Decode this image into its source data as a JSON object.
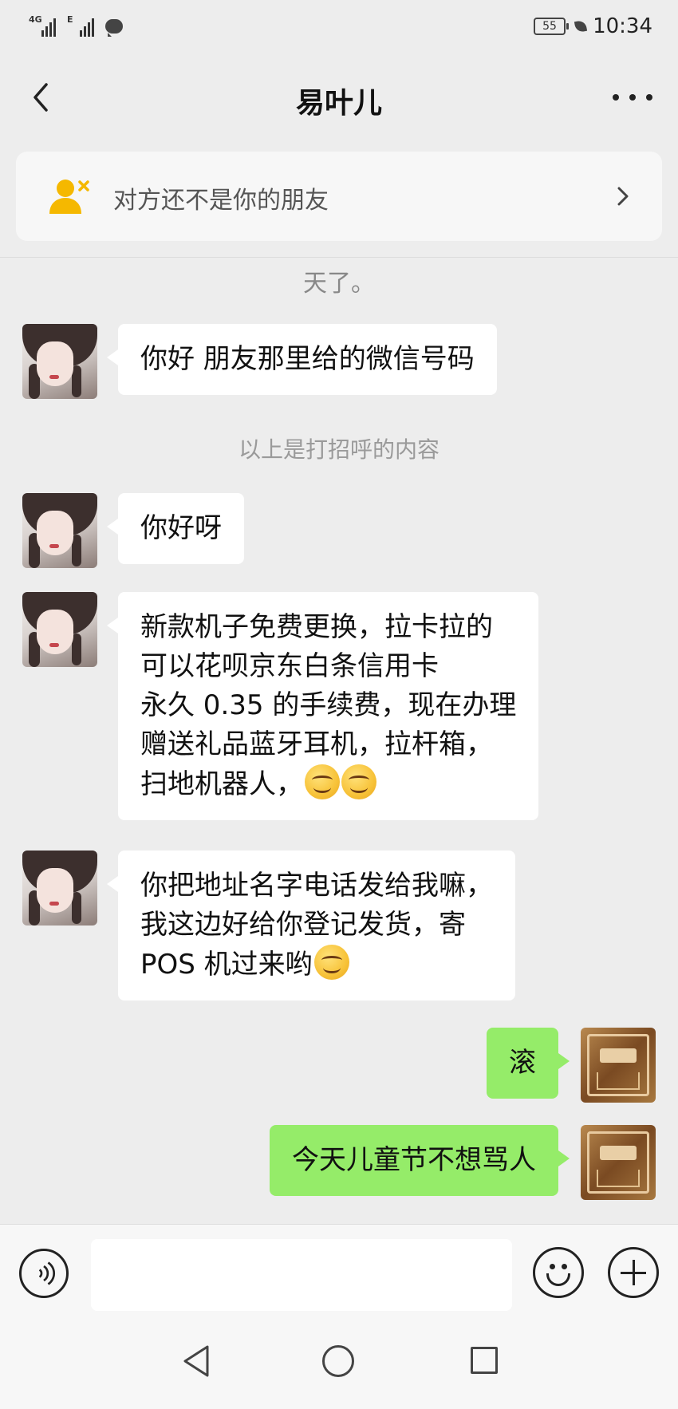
{
  "status_bar": {
    "signal1_tag": "4G",
    "signal2_tag": "E",
    "battery": "55",
    "time": "10:34"
  },
  "header": {
    "title": "易叶儿"
  },
  "notice": {
    "text": "对方还不是你的朋友"
  },
  "chat": {
    "cut_text": "天了。",
    "greeting_hint": "以上是打招呼的内容",
    "messages": [
      {
        "from": "contact",
        "lines": [
          "你好 朋友那里给的微信号码"
        ]
      },
      {
        "from": "contact",
        "lines": [
          "你好呀"
        ]
      },
      {
        "from": "contact",
        "lines": [
          "新款机子免费更换，拉卡拉的",
          "可以花呗京东白条信用卡",
          "永久 0.35 的手续费，现在办理",
          "赠送礼品蓝牙耳机，拉杆箱，",
          "扫地机器人，"
        ]
      },
      {
        "from": "contact",
        "lines": [
          "你把地址名字电话发给我嘛，",
          "我这边好给你登记发货，寄",
          "POS 机过来哟"
        ]
      },
      {
        "from": "me",
        "lines": [
          "滚"
        ]
      },
      {
        "from": "me",
        "lines": [
          "今天儿童节不想骂人"
        ]
      }
    ]
  },
  "icons": {
    "back": "chevron-left-icon",
    "more": "more-dots-icon",
    "notice": "user-x-icon",
    "emoji": "smiley-emoji-icon",
    "voice": "voice-icon",
    "sticker": "emoji-face-icon",
    "plus": "plus-icon"
  },
  "colors": {
    "bubble_me": "#95ec69",
    "bubble_contact": "#ffffff",
    "notice_icon": "#f5b800"
  }
}
